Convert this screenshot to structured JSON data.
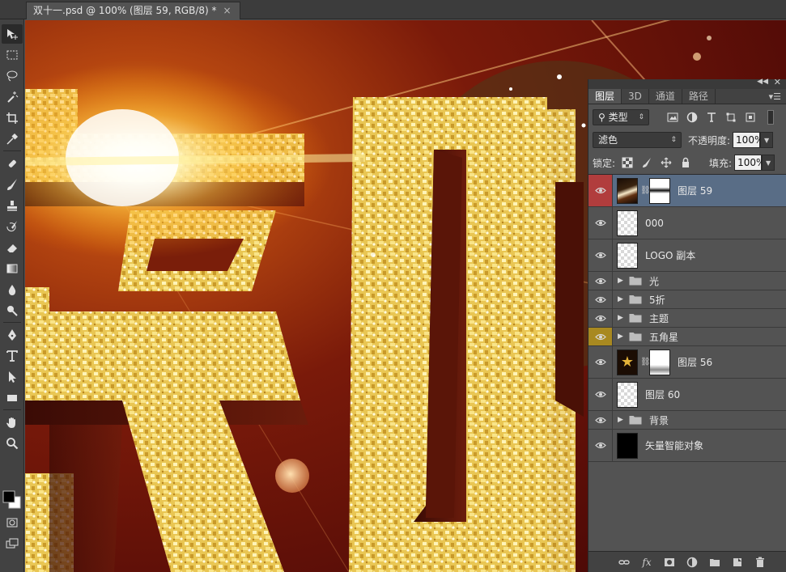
{
  "document_tab": {
    "title": "双十一.psd @ 100% (图层 59, RGB/8) *",
    "close_glyph": "×"
  },
  "tools": [
    {
      "name": "move-tool",
      "icon": "move-icon"
    },
    {
      "name": "marquee-tool",
      "icon": "marquee-icon"
    },
    {
      "name": "lasso-tool",
      "icon": "lasso-icon"
    },
    {
      "name": "magic-wand-tool",
      "icon": "magic-wand-icon"
    },
    {
      "name": "crop-tool",
      "icon": "crop-icon"
    },
    {
      "name": "eyedropper-tool",
      "icon": "eyedropper-icon"
    },
    {
      "name": "healing-brush-tool",
      "icon": "bandage-icon"
    },
    {
      "name": "brush-tool",
      "icon": "brush-icon"
    },
    {
      "name": "clone-stamp-tool",
      "icon": "stamp-icon"
    },
    {
      "name": "history-brush-tool",
      "icon": "history-brush-icon"
    },
    {
      "name": "eraser-tool",
      "icon": "eraser-icon"
    },
    {
      "name": "gradient-tool",
      "icon": "gradient-icon"
    },
    {
      "name": "blur-tool",
      "icon": "drop-icon"
    },
    {
      "name": "dodge-tool",
      "icon": "dodge-icon"
    },
    {
      "name": "pen-tool",
      "icon": "pen-icon"
    },
    {
      "name": "type-tool",
      "icon": "type-icon"
    },
    {
      "name": "path-selection-tool",
      "icon": "arrow-icon"
    },
    {
      "name": "rectangle-tool",
      "icon": "rectangle-icon"
    },
    {
      "name": "hand-tool",
      "icon": "hand-icon"
    },
    {
      "name": "zoom-tool",
      "icon": "zoom-icon"
    }
  ],
  "colors": {
    "foreground": "#000000",
    "background": "#ffffff",
    "selected_layer": "#596d86",
    "visibility_red": "#b13d3d",
    "visibility_gold": "#a88920"
  },
  "layers_panel": {
    "tabs": [
      {
        "label": "图层",
        "active": true
      },
      {
        "label": "3D",
        "active": false
      },
      {
        "label": "通道",
        "active": false
      },
      {
        "label": "路径",
        "active": false
      }
    ],
    "filter": {
      "kind_label": "类型"
    },
    "blend_mode": "滤色",
    "opacity_label": "不透明度:",
    "opacity_value": "100%",
    "lock_label": "锁定:",
    "fill_label": "填充:",
    "fill_value": "100%",
    "layers": [
      {
        "name": "图层 59",
        "type": "pixel-mask",
        "thumb": "photo",
        "mask": "mask",
        "selected": true,
        "eye": "red"
      },
      {
        "name": "000",
        "type": "pixel",
        "thumb": "transparent"
      },
      {
        "name": "LOGO 副本",
        "type": "pixel",
        "thumb": "transparent"
      },
      {
        "name": "光",
        "type": "group"
      },
      {
        "name": "5折",
        "type": "group"
      },
      {
        "name": "主题",
        "type": "group"
      },
      {
        "name": "五角星",
        "type": "group",
        "eye": "gold"
      },
      {
        "name": "图层 56",
        "type": "pixel-mask",
        "thumb": "star",
        "mask": "mask2"
      },
      {
        "name": "图层 60",
        "type": "pixel",
        "thumb": "transparent"
      },
      {
        "name": "背景",
        "type": "group"
      },
      {
        "name": "矢量智能对象",
        "type": "pixel",
        "thumb": "dark"
      }
    ],
    "bottom_icons": [
      "link-icon",
      "fx-icon",
      "mask-icon",
      "adjustment-icon",
      "folder-icon",
      "new-layer-icon",
      "trash-icon"
    ],
    "fx_label": "fx"
  }
}
